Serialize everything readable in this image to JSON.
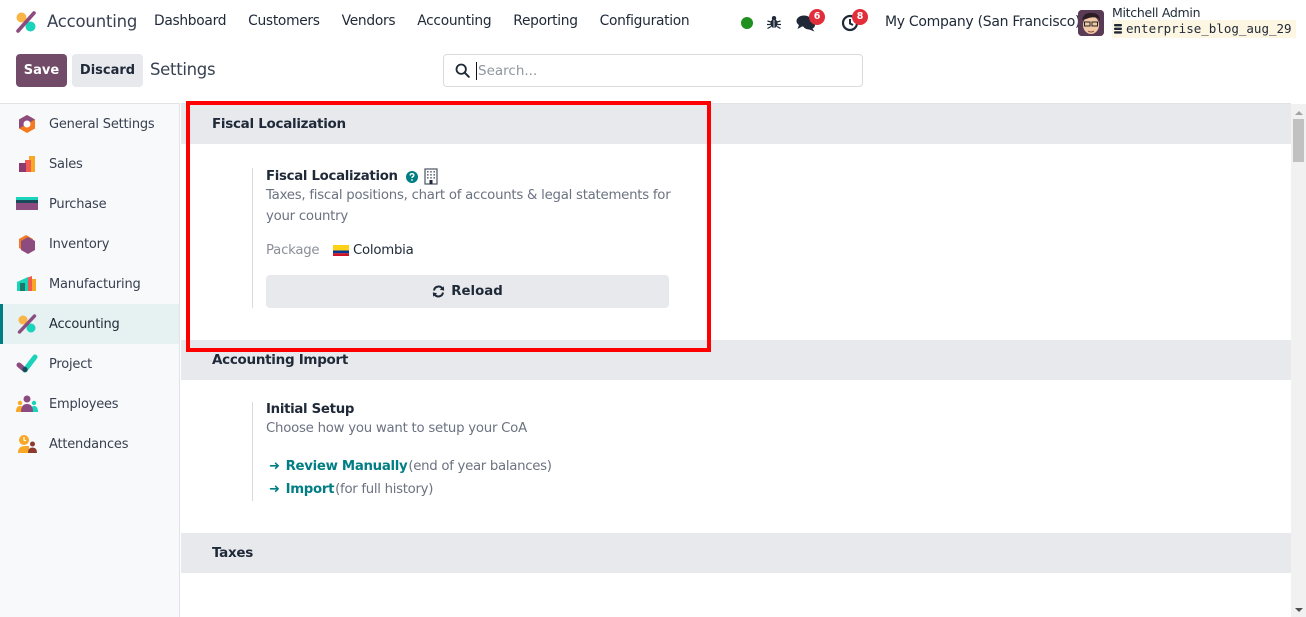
{
  "navbar": {
    "app_name": "Accounting",
    "menu": [
      "Dashboard",
      "Customers",
      "Vendors",
      "Accounting",
      "Reporting",
      "Configuration"
    ],
    "chat_count": "6",
    "activity_count": "8",
    "company": "My Company (San Francisco)",
    "user_name": "Mitchell Admin",
    "database": "enterprise_blog_aug_29",
    "presence_color": "#1f8f1f"
  },
  "control_panel": {
    "save_label": "Save",
    "discard_label": "Discard",
    "title": "Settings",
    "search_placeholder": "Search...",
    "search_value": ""
  },
  "sidebar": {
    "items": [
      {
        "label": "General Settings",
        "icon": "general-settings-icon"
      },
      {
        "label": "Sales",
        "icon": "sales-icon"
      },
      {
        "label": "Purchase",
        "icon": "purchase-icon"
      },
      {
        "label": "Inventory",
        "icon": "inventory-icon"
      },
      {
        "label": "Manufacturing",
        "icon": "manufacturing-icon"
      },
      {
        "label": "Accounting",
        "icon": "accounting-icon",
        "active": true
      },
      {
        "label": "Project",
        "icon": "project-icon"
      },
      {
        "label": "Employees",
        "icon": "employees-icon"
      },
      {
        "label": "Attendances",
        "icon": "attendances-icon"
      }
    ]
  },
  "sections": {
    "fiscal": {
      "header": "Fiscal Localization",
      "setting_title": "Fiscal Localization",
      "description": "Taxes, fiscal positions, chart of accounts & legal statements for your country",
      "package_label": "Package",
      "package_value": "Colombia",
      "reload_label": "Reload"
    },
    "import": {
      "header": "Accounting Import",
      "setting_title": "Initial Setup",
      "description": "Choose how you want to setup your CoA",
      "links": [
        {
          "label": "Review Manually",
          "note": "(end of year balances)"
        },
        {
          "label": "Import",
          "note": "(for full history)"
        }
      ]
    },
    "taxes": {
      "header": "Taxes"
    }
  },
  "colors": {
    "brand": "#714b67",
    "accent": "#017e84",
    "highlight": "#ff0000",
    "badge": "#e22e3a"
  }
}
